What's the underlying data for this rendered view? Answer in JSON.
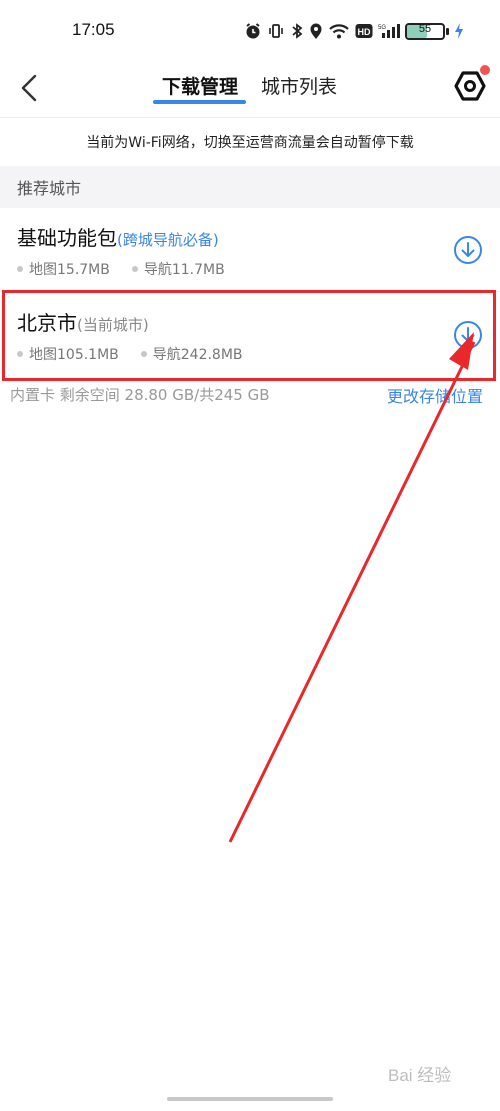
{
  "status_bar": {
    "time": "17:05",
    "battery_level": "55",
    "icons": [
      "alarm-icon",
      "vibrate-icon",
      "bluetooth-icon",
      "location-icon",
      "wifi-icon",
      "hd-icon",
      "cellular-icon",
      "battery-icon",
      "charging-icon"
    ]
  },
  "header": {
    "tabs": [
      {
        "label": "下载管理",
        "active": true
      },
      {
        "label": "城市列表",
        "active": false
      }
    ],
    "accent_color": "#3a86e8"
  },
  "notice": "当前为Wi-Fi网络，切换至运营商流量会自动暂停下载",
  "section_title": "推荐城市",
  "cities": [
    {
      "name": "基础功能包",
      "sub": "(跨城导航必备)",
      "map_size": "地图15.7MB",
      "nav_size": "导航11.7MB"
    },
    {
      "name": "北京市",
      "sub": "(当前城市)",
      "map_size": "地图105.1MB",
      "nav_size": "导航242.8MB"
    }
  ],
  "storage": {
    "info": "内置卡 剩余空间 28.80 GB/共245 GB",
    "change_link": "更改存储位置"
  },
  "watermark": "Bai 经验",
  "annotation_color": "#e8282a"
}
